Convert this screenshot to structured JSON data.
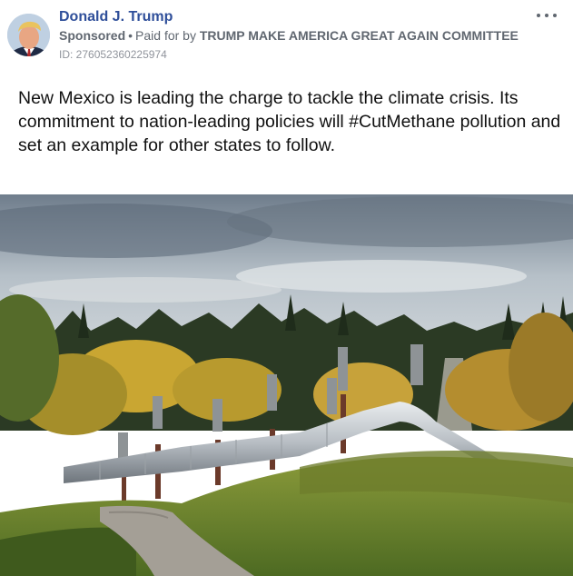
{
  "post": {
    "author": "Donald J. Trump",
    "sponsored_label": "Sponsored",
    "separator": "•",
    "paid_for_prefix": "Paid for by",
    "committee": "TRUMP MAKE AMERICA GREAT AGAIN COMMITTEE",
    "ad_id": "ID: 276052360225974",
    "body": "New Mexico is leading the charge to tackle the climate crisis. Its commitment to nation-leading policies will #CutMethane pollution and set an example for other states to follow.",
    "more_icon": "more-options-icon",
    "image_subject": "pipeline-landscape-photo"
  },
  "colors": {
    "name_link": "#2f4f9a",
    "meta_text": "#606770",
    "id_text": "#90949c",
    "body_text": "#111111"
  }
}
